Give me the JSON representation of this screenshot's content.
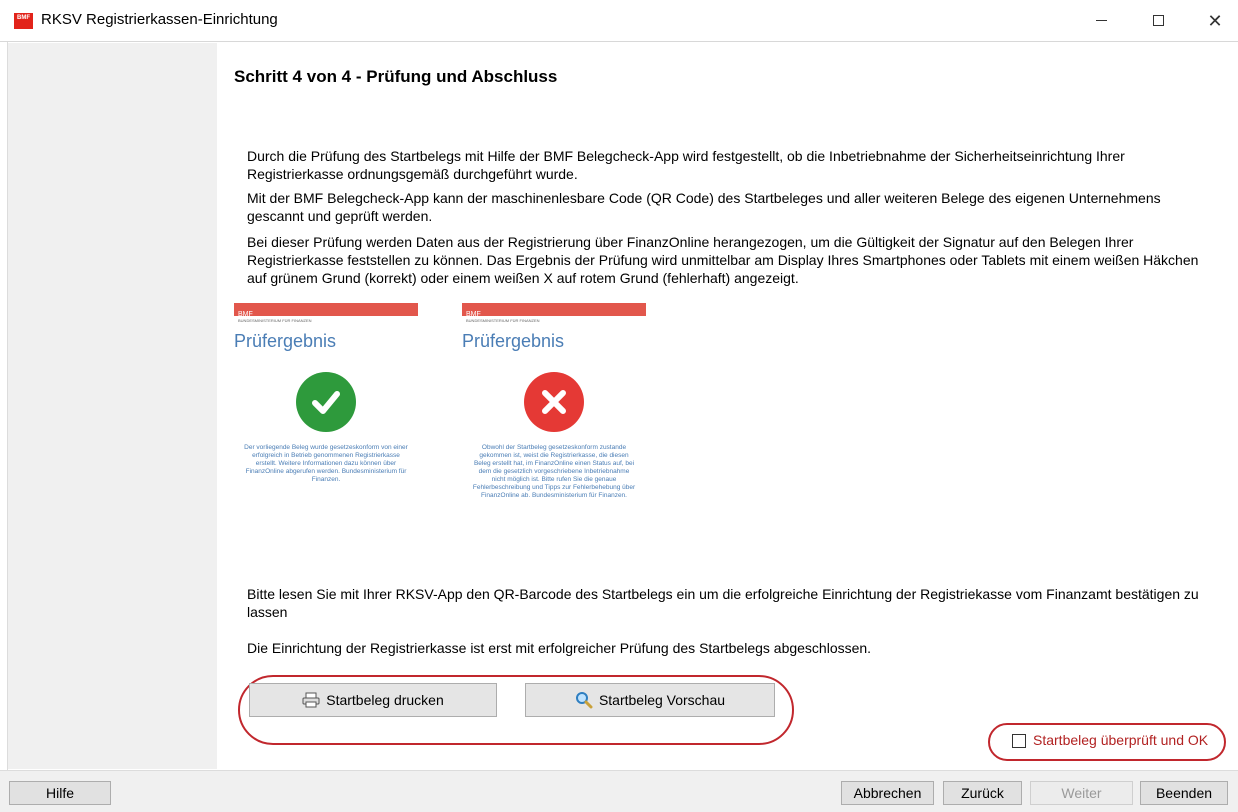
{
  "window": {
    "title": "RKSV Registrierkassen-Einrichtung",
    "icon_text": "BMF",
    "close_glyph": "✕"
  },
  "content": {
    "step_title": "Schritt 4 von 4 - Prüfung und Abschluss",
    "paragraph1": "Durch die Prüfung des Startbelegs mit Hilfe der BMF Belegcheck-App wird festgestellt, ob die Inbetriebnahme der Sicherheitseinrichtung Ihrer Registrierkasse ordnungsgemäß durchgeführt wurde.",
    "paragraph2": "Mit der BMF Belegcheck-App kann der maschinenlesbare Code (QR Code) des Startbeleges und aller weiteren Belege des eigenen Unternehmens gescannt und geprüft werden.",
    "paragraph3": "Bei dieser Prüfung werden Daten aus der Registrierung über FinanzOnline herangezogen, um die Gültigkeit der Signatur auf den Belegen Ihrer Registrierkasse feststellen zu können. Das Ergebnis der Prüfung wird unmittelbar am Display Ihres Smartphones oder Tablets mit einem weißen Häkchen auf grünem Grund (korrekt) oder einem weißen X auf rotem Grund (fehlerhaft) angezeigt.",
    "paragraph4": "Bitte lesen Sie mit Ihrer RKSV-App den QR-Barcode des Startbelegs ein um die erfolgreiche Einrichtung der Registriekasse vom Finanzamt bestätigen zu lassen",
    "paragraph5": "Die Einrichtung der Registrierkasse ist erst mit erfolgreicher Prüfung des Startbelegs abgeschlossen."
  },
  "cards": {
    "ok": {
      "header": "BMF",
      "ministry": "BUNDESMINISTERIUM FÜR FINANZEN",
      "title": "Prüfergebnis",
      "text": "Der vorliegende Beleg wurde gesetzeskonform von einer erfolgreich in Betrieb genommenen Registrierkasse erstellt. Weitere Informationen dazu können über FinanzOnline abgerufen werden. Bundesministerium für Finanzen."
    },
    "error": {
      "header": "BMF",
      "ministry": "BUNDESMINISTERIUM FÜR FINANZEN",
      "title": "Prüfergebnis",
      "text": "Obwohl der Startbeleg gesetzeskonform zustande gekommen ist, weist die Registrierkasse, die diesen Beleg erstellt hat, im FinanzOnline einen Status auf, bei dem die gesetzlich vorgeschriebene Inbetriebnahme nicht möglich ist. Bitte rufen Sie die genaue Fehlerbeschreibung und Tipps zur Fehlerbehebung über FinanzOnline ab. Bundesministerium für Finanzen."
    }
  },
  "actions": {
    "print_label": "Startbeleg drucken",
    "preview_label": "Startbeleg Vorschau",
    "checkbox_label": "Startbeleg überprüft und OK",
    "checkbox_checked": false
  },
  "footer": {
    "help": "Hilfe",
    "cancel": "Abbrechen",
    "back": "Zurück",
    "next": "Weiter",
    "finish": "Beenden"
  },
  "colors": {
    "ok_green": "#2e9a3c",
    "error_red": "#e53935",
    "highlight_red": "#c1272d",
    "card_blue": "#4a7db5"
  }
}
